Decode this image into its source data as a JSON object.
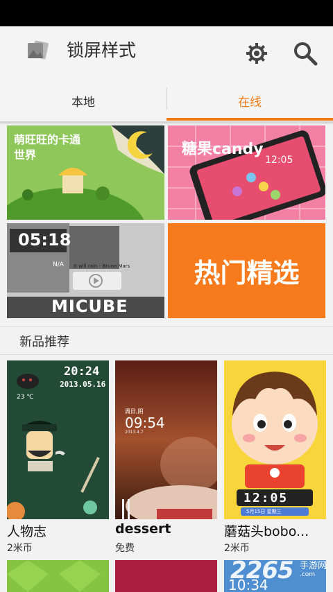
{
  "action_bar": {
    "title": "锁屏样式",
    "icons": [
      "app-icon",
      "settings-gear-icon",
      "search-icon"
    ]
  },
  "tabs": [
    {
      "label": "本地",
      "active": false
    },
    {
      "label": "在线",
      "active": true
    }
  ],
  "accent_color": "#f07a14",
  "banners": [
    {
      "text": "萌旺旺的卡通世界"
    },
    {
      "text": "糖果candy",
      "time": "12:05"
    },
    {
      "text": "MICUBE",
      "time": "05:18",
      "music": "It will rain - Bruno Mars",
      "weather": "N/A"
    },
    {
      "text": "热门精选"
    }
  ],
  "section": {
    "title": "新品推荐"
  },
  "themes": [
    {
      "name": "人物志",
      "price": "2米币",
      "time": "20:24",
      "date": "2013.05.16",
      "temp": "23 ℃"
    },
    {
      "name": "dessert",
      "price": "免费",
      "time": "09:54",
      "day": "周日,阴",
      "date": "2013.4.7"
    },
    {
      "name": "蘑菇头bobo...",
      "price": "2米币",
      "time": "12:05",
      "date": "5月15日 星期三"
    }
  ],
  "bottom_row": {
    "time": "10:34"
  },
  "watermark": {
    "text": "2265",
    "suffix": ".com",
    "sub": "手游网"
  }
}
